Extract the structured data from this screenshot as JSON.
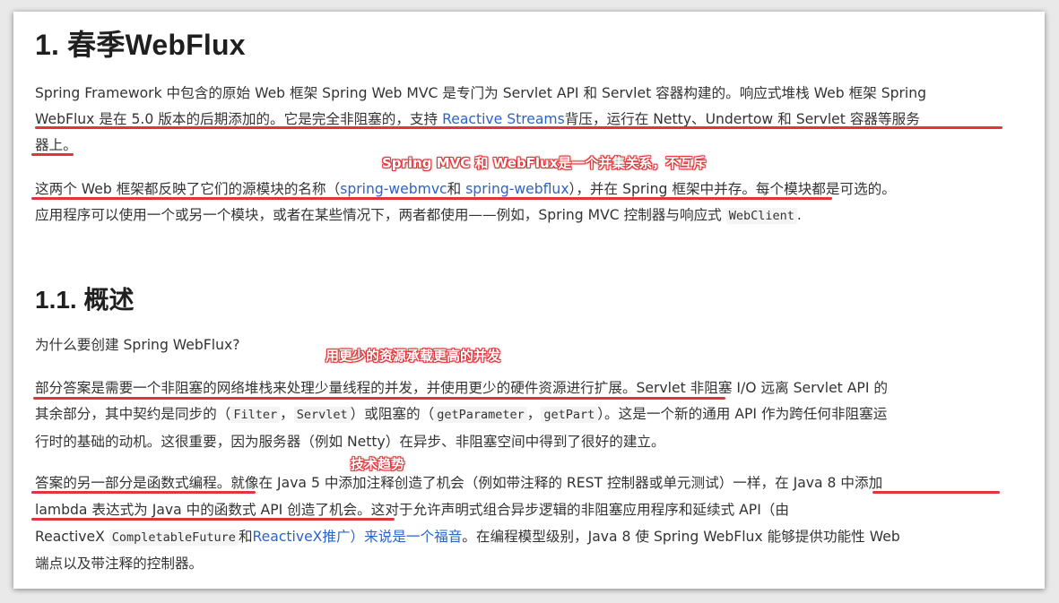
{
  "heading_main": "1. 春季WebFlux",
  "para1": {
    "line1": "Spring Framework 中包含的原始 Web 框架 Spring Web MVC 是专门为 Servlet API 和 Servlet 容器构建的。响应式堆栈 Web 框架 Spring",
    "line2_a": "WebFlux 是在 5.0 版本的后期添加的。它是完全非阻塞的，支持 ",
    "line2_link": "Reactive Streams",
    "line2_b": "背压，运行在 Netty、Undertow 和 Servlet 容器等服务",
    "line3": "器上。"
  },
  "annotation1": "Spring MVC 和 WebFlux是一个并集关系，不互斥",
  "para2": {
    "line1_a": "这两个 Web 框架都反映了它们的源模块的名称（",
    "line1_link1": "spring-webmvc",
    "line1_mid": "和 ",
    "line1_link2": "spring-webflux",
    "line1_b": "），并在 Spring 框架中并存。每个模块都是可选的。",
    "line2_a": "应用程序可以使用一个或另一个模块，或者在某些情况下，两者都使用——例如，Spring MVC 控制器与响应式 ",
    "line2_code": "WebClient",
    "line2_b": "."
  },
  "heading_sub": "1.1. 概述",
  "question": "为什么要创建 Spring WebFlux?",
  "annotation2": "用更少的资源承载更高的并发",
  "para3": {
    "line1": "部分答案是需要一个非阻塞的网络堆栈来处理少量线程的并发，并使用更少的硬件资源进行扩展。Servlet 非阻塞 I/O 远离 Servlet API 的",
    "line2_a": "其余部分，其中契约是同步的（",
    "line2_code1": "Filter",
    "line2_sep": "，",
    "line2_code2": "Servlet",
    "line2_b": "）或阻塞的（",
    "line2_code3": "getParameter",
    "line2_sep2": "，",
    "line2_code4": "getPart",
    "line2_c": "）。这是一个新的通用 API 作为跨任何非阻塞运",
    "line3": "行时的基础的动机。这很重要，因为服务器（例如 Netty）在异步、非阻塞空间中得到了很好的建立。"
  },
  "annotation3": "技术趋势",
  "para4": {
    "line1": "答案的另一部分是函数式编程。就像在 Java 5 中添加注释创造了机会（例如带注释的 REST 控制器或单元测试）一样，在 Java 8 中添加",
    "line2": "lambda 表达式为 Java 中的函数式 API 创造了机会。这对于允许声明式组合异步逻辑的非阻塞应用程序和延续式 API（由",
    "line3_a": "ReactiveX ",
    "line3_code": "CompletableFuture",
    "line3_mid": "和",
    "line3_link": "ReactiveX推广）来说是一个福音",
    "line3_b": "。在编程模型级别，Java 8 使 Spring WebFlux 能够提供功能性 Web",
    "line4": "端点以及带注释的控制器。"
  },
  "colors": {
    "annotation_red": "#e0353a",
    "link_blue": "#2b64c8",
    "text": "#333333"
  }
}
